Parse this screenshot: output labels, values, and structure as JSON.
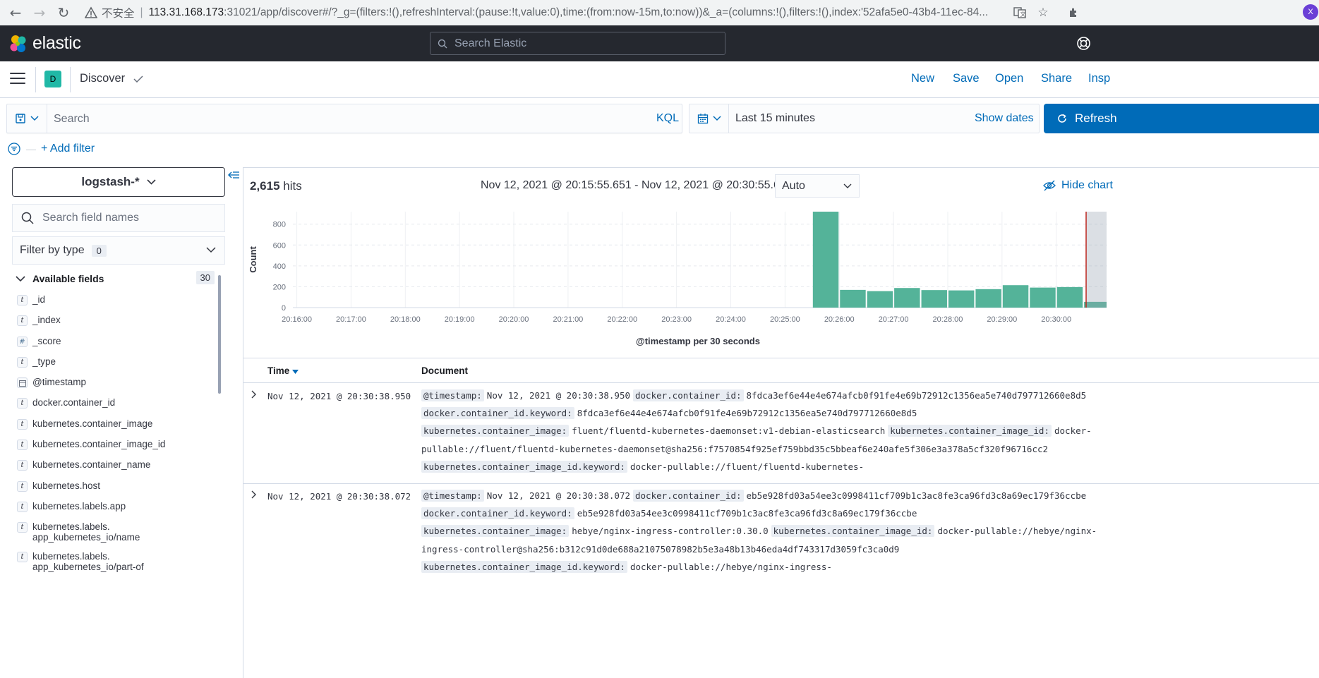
{
  "browser": {
    "insecure_label": "不安全",
    "url_host": "113.31.168.173",
    "url_rest": ":31021/app/discover#/?_g=(filters:!(),refreshInterval:(pause:!t,value:0),time:(from:now-15m,to:now))&_a=(columns:!(),filters:!(),index:'52afa5e0-43b4-11ec-84...",
    "avatar_letter": "X"
  },
  "header": {
    "brand": "elastic",
    "search_placeholder": "Search Elastic"
  },
  "app": {
    "space_letter": "D",
    "breadcrumb": "Discover",
    "links": [
      "New",
      "Save",
      "Open",
      "Share",
      "Insp"
    ]
  },
  "query": {
    "placeholder": "Search",
    "language": "KQL",
    "date_label": "Last 15 minutes",
    "show_dates": "Show dates",
    "refresh": "Refresh",
    "add_filter": "+ Add filter"
  },
  "sidebar": {
    "index_pattern": "logstash-*",
    "field_search_placeholder": "Search field names",
    "filter_by_type": "Filter by type",
    "filter_count": "0",
    "available_fields_label": "Available fields",
    "available_count": "30",
    "fields": [
      {
        "type": "t",
        "name": "_id"
      },
      {
        "type": "t",
        "name": "_index"
      },
      {
        "type": "#",
        "name": "_score"
      },
      {
        "type": "t",
        "name": "_type"
      },
      {
        "type": "date",
        "name": "@timestamp"
      },
      {
        "type": "t",
        "name": "docker.container_id"
      },
      {
        "type": "t",
        "name": "kubernetes.container_image"
      },
      {
        "type": "t",
        "name": "kubernetes.container_image_id"
      },
      {
        "type": "t",
        "name": "kubernetes.container_name"
      },
      {
        "type": "t",
        "name": "kubernetes.host"
      },
      {
        "type": "t",
        "name": "kubernetes.labels.app"
      },
      {
        "type": "t",
        "name": "kubernetes.labels.\napp_kubernetes_io/name"
      },
      {
        "type": "t",
        "name": "kubernetes.labels.\napp_kubernetes_io/part-of"
      }
    ]
  },
  "main": {
    "hits_count": "2,615",
    "hits_label": "hits",
    "time_range": "Nov 12, 2021 @ 20:15:55.651 - Nov 12, 2021 @ 20:30:55.651",
    "interval": "Auto",
    "hide_chart": "Hide chart",
    "table": {
      "time_header": "Time",
      "doc_header": "Document"
    }
  },
  "chart_data": {
    "type": "bar",
    "title": "",
    "xlabel": "@timestamp per 30 seconds",
    "ylabel": "Count",
    "ylim": [
      0,
      920
    ],
    "y_ticks": [
      0,
      200,
      400,
      600,
      800
    ],
    "x_ticks": [
      "20:16:00",
      "20:17:00",
      "20:18:00",
      "20:19:00",
      "20:20:00",
      "20:21:00",
      "20:22:00",
      "20:23:00",
      "20:24:00",
      "20:25:00",
      "20:26:00",
      "20:27:00",
      "20:28:00",
      "20:29:00",
      "20:30:00"
    ],
    "categories": [
      "20:25:30",
      "20:26:00",
      "20:26:30",
      "20:27:00",
      "20:27:30",
      "20:28:00",
      "20:28:30",
      "20:29:00",
      "20:29:30",
      "20:30:00",
      "20:30:30"
    ],
    "values": [
      920,
      170,
      158,
      188,
      168,
      165,
      177,
      215,
      192,
      197,
      55
    ],
    "color": "#54b399"
  },
  "documents": [
    {
      "time": "Nov 12, 2021 @ 20:30:38.950",
      "lines": [
        [
          [
            "@timestamp:",
            "Nov 12, 2021 @ 20:30:38.950"
          ],
          [
            "docker.container_id:",
            "8fdca3ef6e44e4e674afcb0f91fe4e69b72912c1356ea5e740d797712660e8d5"
          ]
        ],
        [
          [
            "docker.container_id.keyword:",
            "8fdca3ef6e44e4e674afcb0f91fe4e69b72912c1356ea5e740d797712660e8d5"
          ]
        ],
        [
          [
            "kubernetes.container_image:",
            "fluent/fluentd-kubernetes-daemonset:v1-debian-elasticsearch"
          ],
          [
            "kubernetes.container_image_id:",
            "docker-"
          ]
        ],
        [
          [
            "",
            "pullable://fluent/fluentd-kubernetes-daemonset@sha256:f7570854f925ef759bbd35c5bbeaf6e240afe5f306e3a378a5cf320f96716cc2"
          ]
        ],
        [
          [
            "kubernetes.container_image_id.keyword:",
            "docker-pullable://fluent/fluentd-kubernetes-"
          ]
        ]
      ]
    },
    {
      "time": "Nov 12, 2021 @ 20:30:38.072",
      "lines": [
        [
          [
            "@timestamp:",
            "Nov 12, 2021 @ 20:30:38.072"
          ],
          [
            "docker.container_id:",
            "eb5e928fd03a54ee3c0998411cf709b1c3ac8fe3ca96fd3c8a69ec179f36ccbe"
          ]
        ],
        [
          [
            "docker.container_id.keyword:",
            "eb5e928fd03a54ee3c0998411cf709b1c3ac8fe3ca96fd3c8a69ec179f36ccbe"
          ]
        ],
        [
          [
            "kubernetes.container_image:",
            "hebye/nginx-ingress-controller:0.30.0"
          ],
          [
            "kubernetes.container_image_id:",
            "docker-pullable://hebye/nginx-"
          ]
        ],
        [
          [
            "",
            "ingress-controller@sha256:b312c91d0de688a21075078982b5e3a48b13b46eda4df743317d3059fc3ca0d9"
          ]
        ],
        [
          [
            "kubernetes.container_image_id.keyword:",
            "docker-pullable://hebye/nginx-ingress-"
          ]
        ]
      ]
    }
  ]
}
